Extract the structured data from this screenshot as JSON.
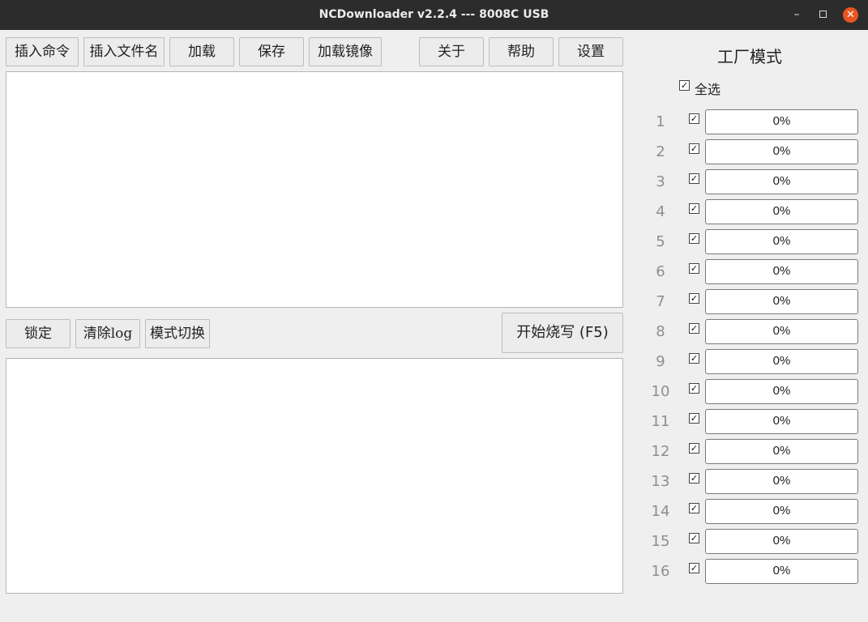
{
  "window": {
    "title": "NCDownloader v2.2.4 --- 8008C USB",
    "minimize_glyph": "–",
    "close_glyph": "✕"
  },
  "toolbar": {
    "insert_command": "插入命令",
    "insert_filename": "插入文件名",
    "load": "加载",
    "save": "保存",
    "load_image": "加载镜像",
    "about": "关于",
    "help": "帮助",
    "settings": "设置"
  },
  "controls": {
    "lock": "锁定",
    "clear_log": "清除log",
    "mode_switch": "模式切换",
    "start_burn": "开始烧写 (F5)"
  },
  "editor": {
    "value": ""
  },
  "log": {
    "value": ""
  },
  "factory": {
    "title": "工厂模式",
    "select_all_label": "全选",
    "select_all_checked": true,
    "check_glyph": "✓",
    "channels": [
      {
        "num": "1",
        "checked": true,
        "progress": "0%"
      },
      {
        "num": "2",
        "checked": true,
        "progress": "0%"
      },
      {
        "num": "3",
        "checked": true,
        "progress": "0%"
      },
      {
        "num": "4",
        "checked": true,
        "progress": "0%"
      },
      {
        "num": "5",
        "checked": true,
        "progress": "0%"
      },
      {
        "num": "6",
        "checked": true,
        "progress": "0%"
      },
      {
        "num": "7",
        "checked": true,
        "progress": "0%"
      },
      {
        "num": "8",
        "checked": true,
        "progress": "0%"
      },
      {
        "num": "9",
        "checked": true,
        "progress": "0%"
      },
      {
        "num": "10",
        "checked": true,
        "progress": "0%"
      },
      {
        "num": "11",
        "checked": true,
        "progress": "0%"
      },
      {
        "num": "12",
        "checked": true,
        "progress": "0%"
      },
      {
        "num": "13",
        "checked": true,
        "progress": "0%"
      },
      {
        "num": "14",
        "checked": true,
        "progress": "0%"
      },
      {
        "num": "15",
        "checked": true,
        "progress": "0%"
      },
      {
        "num": "16",
        "checked": true,
        "progress": "0%"
      }
    ]
  }
}
